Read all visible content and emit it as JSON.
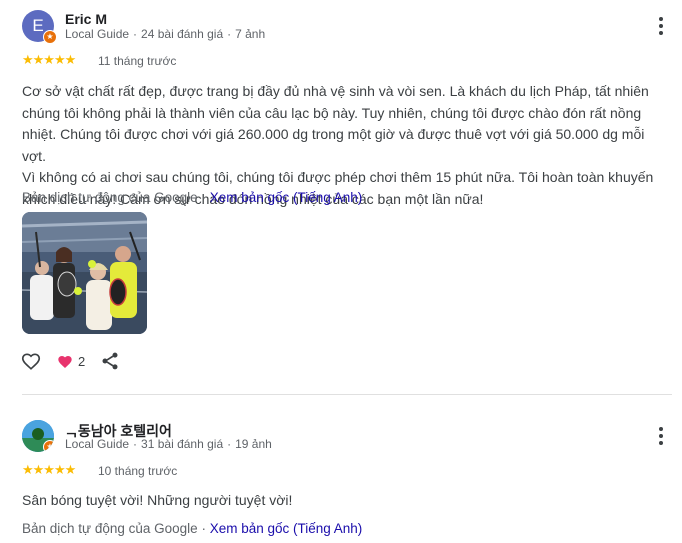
{
  "reviews": [
    {
      "avatar_letter": "E",
      "name": "Eric M",
      "meta": {
        "guide": "Local Guide",
        "reviews": "24 bài đánh giá",
        "photos": "7 ảnh"
      },
      "stars": "★★★★★",
      "rating": 5,
      "time": "11 tháng trước",
      "lines": [
        "Cơ sở vật chất rất đẹp, được trang bị đầy đủ nhà vệ sinh và vòi sen. Là khách du lịch Pháp, tất nhiên",
        "chúng tôi không phải là thành viên của câu lạc bộ này. Tuy nhiên, chúng tôi được chào đón rất nồng",
        "nhiệt. Chúng tôi được chơi với giá 260.000 dg trong một giờ và được thuê vợt với giá 50.000 dg mỗi vợt.",
        "Vì không có ai chơi sau chúng tôi, chúng tôi được phép chơi thêm 15 phút nữa. Tôi hoàn toàn khuyến",
        "khích điều này! Cảm ơn sự chào đón nồng nhiệt của các bạn một lần nữa!"
      ],
      "translation_note": "Bản dịch tự động của Google",
      "translation_separator": "·",
      "view_original": "Xem bản gốc (Tiếng Anh)",
      "like_count": "2"
    },
    {
      "name": "ᆨ동남아 호텔리어",
      "meta": {
        "guide": "Local Guide",
        "reviews": "31 bài đánh giá",
        "photos": "19 ảnh"
      },
      "stars": "★★★★★",
      "rating": 5,
      "time": "10 tháng trước",
      "text": "Sân bóng tuyệt vời! Những người tuyệt vời!",
      "translation_note": "Bản dịch tự động của Google",
      "translation_separator": "·",
      "view_original": "Xem bản gốc (Tiếng Anh)"
    }
  ],
  "colors": {
    "star": "#fbbc04",
    "link": "#1a0dab",
    "heart": "#e8336d",
    "badge": "#e8710a",
    "avatar_e": "#5c6bc0"
  },
  "icons": {
    "badge": "local-guide-star-icon",
    "more": "more-vert-icon",
    "like": "heart-outline-icon",
    "reaction": "heart-filled-icon",
    "share": "share-icon"
  }
}
